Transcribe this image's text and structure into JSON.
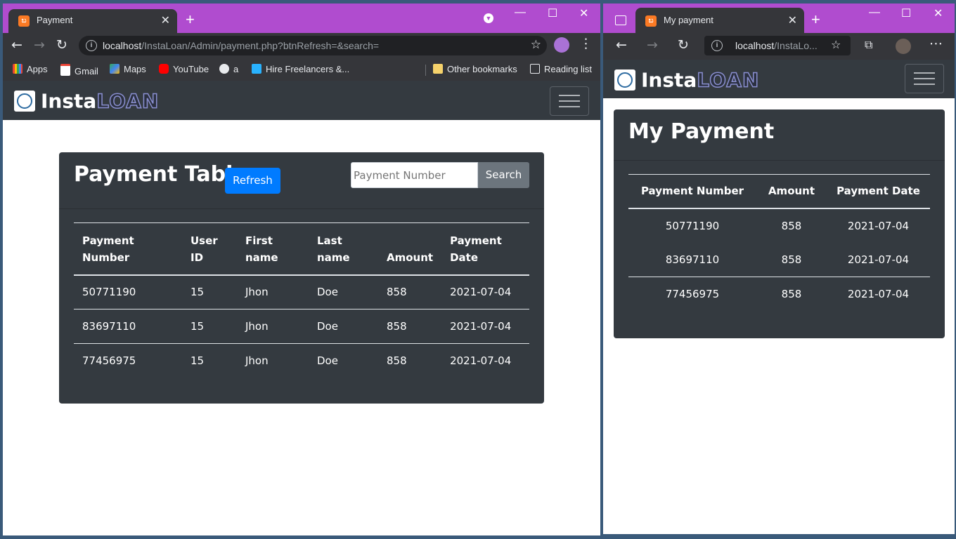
{
  "left_browser": {
    "tab_title": "Payment",
    "url_host": "localhost",
    "url_path": "/InstaLoan/Admin/payment.php?btnRefresh=&search=",
    "bookmarks": [
      "Apps",
      "Gmail",
      "Maps",
      "YouTube",
      "a",
      "Hire Freelancers &..."
    ],
    "other_bookmarks": "Other bookmarks",
    "reading_list": "Reading list"
  },
  "right_browser": {
    "tab_title": "My payment",
    "url_host": "localhost",
    "url_path": "/InstaLo..."
  },
  "logo": {
    "insta": "Insta",
    "loan": "LOAN"
  },
  "admin_page": {
    "title": "Payment Table",
    "refresh_label": "Refresh",
    "search_placeholder": "Payment Number",
    "search_label": "Search",
    "columns": [
      "Payment Number",
      "User ID",
      "First name",
      "Last name",
      "Amount",
      "Payment Date"
    ],
    "rows": [
      [
        "50771190",
        "15",
        "Jhon",
        "Doe",
        "858",
        "2021-07-04"
      ],
      [
        "83697110",
        "15",
        "Jhon",
        "Doe",
        "858",
        "2021-07-04"
      ],
      [
        "77456975",
        "15",
        "Jhon",
        "Doe",
        "858",
        "2021-07-04"
      ]
    ]
  },
  "user_page": {
    "title": "My Payment",
    "columns": [
      "Payment Number",
      "Amount",
      "Payment Date"
    ],
    "rows": [
      [
        "50771190",
        "858",
        "2021-07-04"
      ],
      [
        "83697110",
        "858",
        "2021-07-04"
      ],
      [
        "77456975",
        "858",
        "2021-07-04"
      ]
    ]
  },
  "colors": {
    "tab_strip": "#b04ccf",
    "navbar": "#343a40",
    "primary": "#007bff",
    "secondary": "#6c757d"
  }
}
